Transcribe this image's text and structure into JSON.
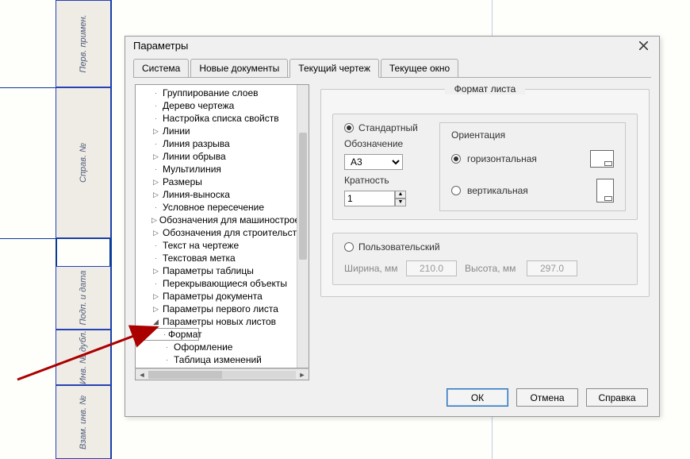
{
  "dialog": {
    "title": "Параметры",
    "tabs": [
      "Система",
      "Новые документы",
      "Текущий чертеж",
      "Текущее окно"
    ],
    "activeTab": 2,
    "buttons": {
      "ok": "ОК",
      "cancel": "Отмена",
      "help": "Справка"
    }
  },
  "tree": [
    {
      "d": 1,
      "t": "Группирование слоев",
      "e": ""
    },
    {
      "d": 1,
      "t": "Дерево чертежа",
      "e": ""
    },
    {
      "d": 1,
      "t": "Настройка списка свойств",
      "e": ""
    },
    {
      "d": 1,
      "t": "Линии",
      "e": ">"
    },
    {
      "d": 1,
      "t": "Линия разрыва",
      "e": ""
    },
    {
      "d": 1,
      "t": "Линии обрыва",
      "e": ">"
    },
    {
      "d": 1,
      "t": "Мультилиния",
      "e": ""
    },
    {
      "d": 1,
      "t": "Размеры",
      "e": ">"
    },
    {
      "d": 1,
      "t": "Линия-выноска",
      "e": ">"
    },
    {
      "d": 1,
      "t": "Условное пересечение",
      "e": ""
    },
    {
      "d": 1,
      "t": "Обозначения для машиностроения",
      "e": ">"
    },
    {
      "d": 1,
      "t": "Обозначения для строительства",
      "e": ">"
    },
    {
      "d": 1,
      "t": "Текст на чертеже",
      "e": ""
    },
    {
      "d": 1,
      "t": "Текстовая метка",
      "e": ""
    },
    {
      "d": 1,
      "t": "Параметры таблицы",
      "e": ">"
    },
    {
      "d": 1,
      "t": "Перекрывающиеся объекты",
      "e": ""
    },
    {
      "d": 1,
      "t": "Параметры документа",
      "e": ">"
    },
    {
      "d": 1,
      "t": "Параметры первого листа",
      "e": ">"
    },
    {
      "d": 1,
      "t": "Параметры новых листов",
      "e": "v"
    },
    {
      "d": 2,
      "t": "Формат",
      "e": "",
      "sel": true
    },
    {
      "d": 2,
      "t": "Оформление",
      "e": ""
    },
    {
      "d": 2,
      "t": "Таблица изменений",
      "e": ""
    }
  ],
  "format": {
    "group_title": "Формат листа",
    "standard_label": "Стандартный",
    "designation_label": "Обозначение",
    "designation_value": "А3",
    "multiplicity_label": "Кратность",
    "multiplicity_value": "1",
    "orientation_label": "Ориентация",
    "horizontal_label": "горизонтальная",
    "vertical_label": "вертикальная",
    "custom_label": "Пользовательский",
    "width_label": "Ширина, мм",
    "width_value": "210.0",
    "height_label": "Высота, мм",
    "height_value": "297.0"
  },
  "bg_labels": {
    "c1": "Перв. примен.",
    "c2": "Справ. №",
    "c3": "Подп. и дата",
    "c4": "Инв. № дубл.",
    "c5": "Взам. инв. №"
  }
}
